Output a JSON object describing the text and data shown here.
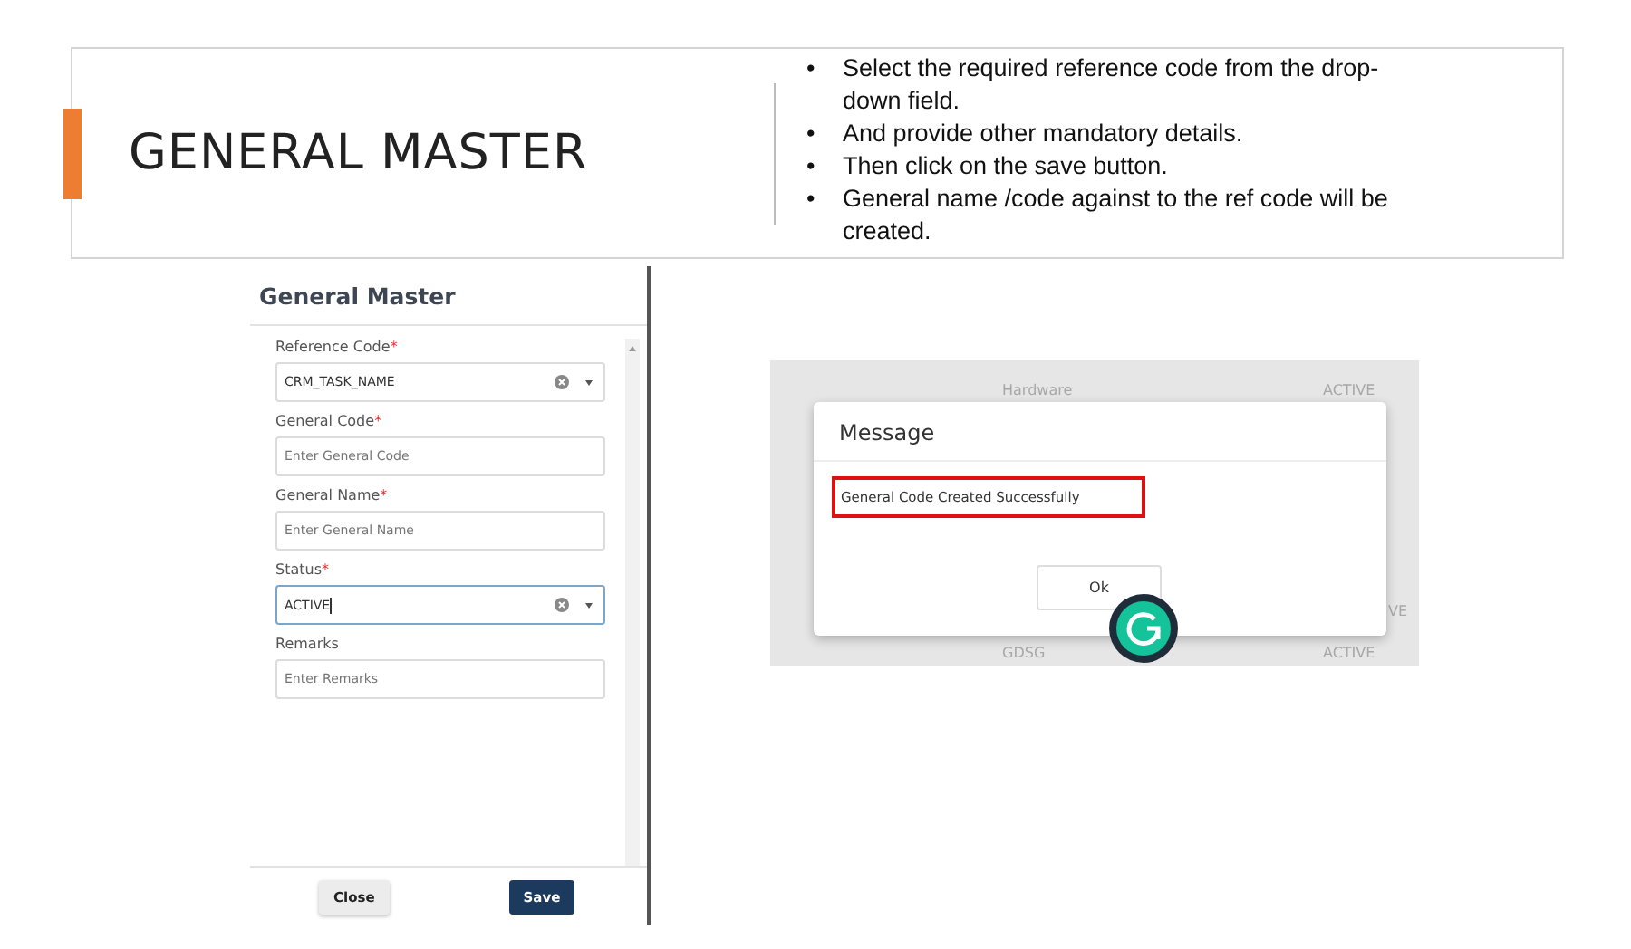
{
  "slide": {
    "title": "GENERAL MASTER",
    "bullet": "•",
    "notes": [
      "Select the required reference code from the drop-down field.",
      "And provide other mandatory details.",
      "Then click on the save button.",
      "General name /code against to the ref code will be created."
    ]
  },
  "form": {
    "title": "General Master",
    "fields": [
      {
        "label": "Reference Code",
        "mark": "*",
        "kind": "select",
        "value": "CRM_TASK_NAME",
        "focused": false
      },
      {
        "label": "General Code",
        "mark": "*",
        "kind": "input",
        "placeholder": "Enter General Code",
        "focused": false
      },
      {
        "label": "General Name",
        "mark": "*",
        "kind": "input",
        "placeholder": "Enter General Name",
        "focused": false
      },
      {
        "label": "Status",
        "mark": "*",
        "kind": "select",
        "value": "ACTIVE",
        "focused": true
      },
      {
        "label": "Remarks",
        "kind": "input",
        "placeholder": "Enter Remarks",
        "focused": false
      }
    ],
    "buttons": [
      {
        "label": "Close",
        "kind": "secondary"
      },
      {
        "label": "Save",
        "kind": "primary"
      }
    ]
  },
  "message_shot": {
    "backdrop": [
      {
        "name": "Hardware",
        "status": "ACTIVE"
      },
      {
        "status": "VE"
      },
      {
        "name": "GDSG",
        "status": "ACTIVE"
      }
    ],
    "dialog": {
      "title": "Message",
      "text": "General Code Created Successfully",
      "button": "Ok"
    }
  }
}
